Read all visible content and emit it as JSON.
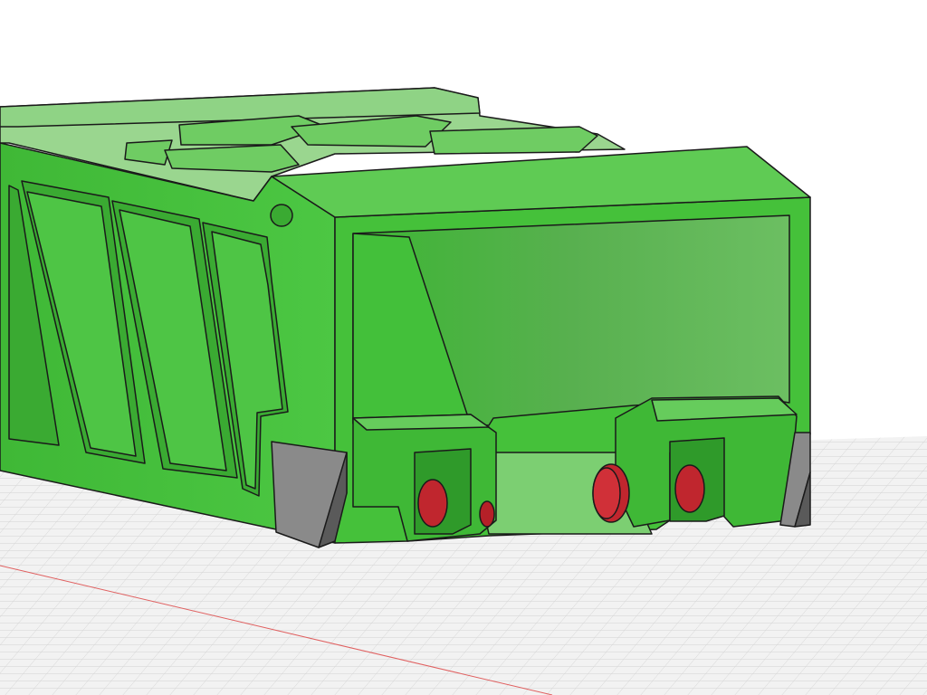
{
  "scene": {
    "model_color": "#45c13a",
    "model_top_color": "#9ad68f",
    "model_dark_color": "#2f9a2a",
    "bumper_color": "#8a8a8a",
    "pin_color": "#c0262e",
    "background_color": "#ffffff",
    "grid_color": "#c8c8c8",
    "x_axis_color": "#e06060"
  },
  "icons": [
    "viewport-grid",
    "axis-line"
  ]
}
